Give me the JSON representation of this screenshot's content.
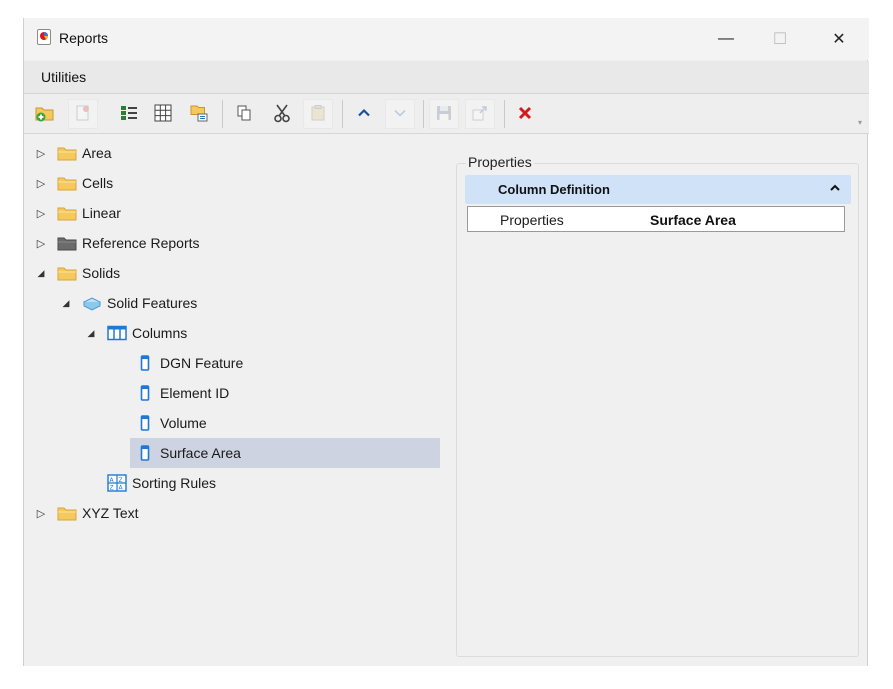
{
  "window": {
    "title": "Reports",
    "minimize_glyph": "—",
    "maximize_glyph": "☐",
    "close_glyph": "✕"
  },
  "menu": {
    "items": [
      "Utilities"
    ]
  },
  "toolbar": {
    "buttons": [
      {
        "name": "add-folder-icon",
        "enabled": true
      },
      {
        "name": "add-report-icon",
        "enabled": false
      },
      {
        "name": "column-definition-icon",
        "enabled": true
      },
      {
        "name": "table-icon",
        "enabled": true
      },
      {
        "name": "sorting-icon",
        "enabled": true
      },
      {
        "name": "copy-icon",
        "enabled": true
      },
      {
        "name": "cut-icon",
        "enabled": true
      },
      {
        "name": "paste-icon",
        "enabled": false
      },
      {
        "name": "move-up-icon",
        "enabled": true
      },
      {
        "name": "move-down-icon",
        "enabled": false
      },
      {
        "name": "save-icon",
        "enabled": false
      },
      {
        "name": "export-icon",
        "enabled": false
      },
      {
        "name": "delete-icon",
        "enabled": true
      }
    ],
    "overflow_glyph": "▾"
  },
  "tree": {
    "expand_collapsed_glyph": "▷",
    "expand_open_glyph": "◢",
    "items": [
      {
        "label": "Area",
        "icon": "folder-icon"
      },
      {
        "label": "Cells",
        "icon": "folder-icon"
      },
      {
        "label": "Linear",
        "icon": "folder-icon"
      },
      {
        "label": "Reference Reports",
        "icon": "dark-folder-icon"
      },
      {
        "label": "Solids",
        "icon": "folder-icon"
      },
      {
        "label": "Solid Features",
        "icon": "solid-feature-icon"
      },
      {
        "label": "Columns",
        "icon": "columns-icon"
      },
      {
        "label": "DGN Feature",
        "icon": "column-icon"
      },
      {
        "label": "Element ID",
        "icon": "column-icon"
      },
      {
        "label": "Volume",
        "icon": "column-icon"
      },
      {
        "label": "Surface Area",
        "icon": "column-icon",
        "selected": true
      },
      {
        "label": "Sorting Rules",
        "icon": "sorting-rules-icon"
      },
      {
        "label": "XYZ Text",
        "icon": "folder-icon"
      }
    ]
  },
  "properties": {
    "panel_title": "Properties",
    "category": "Column Definition",
    "rows": [
      {
        "name": "Properties",
        "value": "Surface Area"
      }
    ]
  },
  "colors": {
    "selection": "#cdd3e0",
    "category_header": "#cfe2f8",
    "folder_yellow": "#f6c95c",
    "accent_blue": "#1e78d7",
    "delete_red": "#d7191c"
  }
}
